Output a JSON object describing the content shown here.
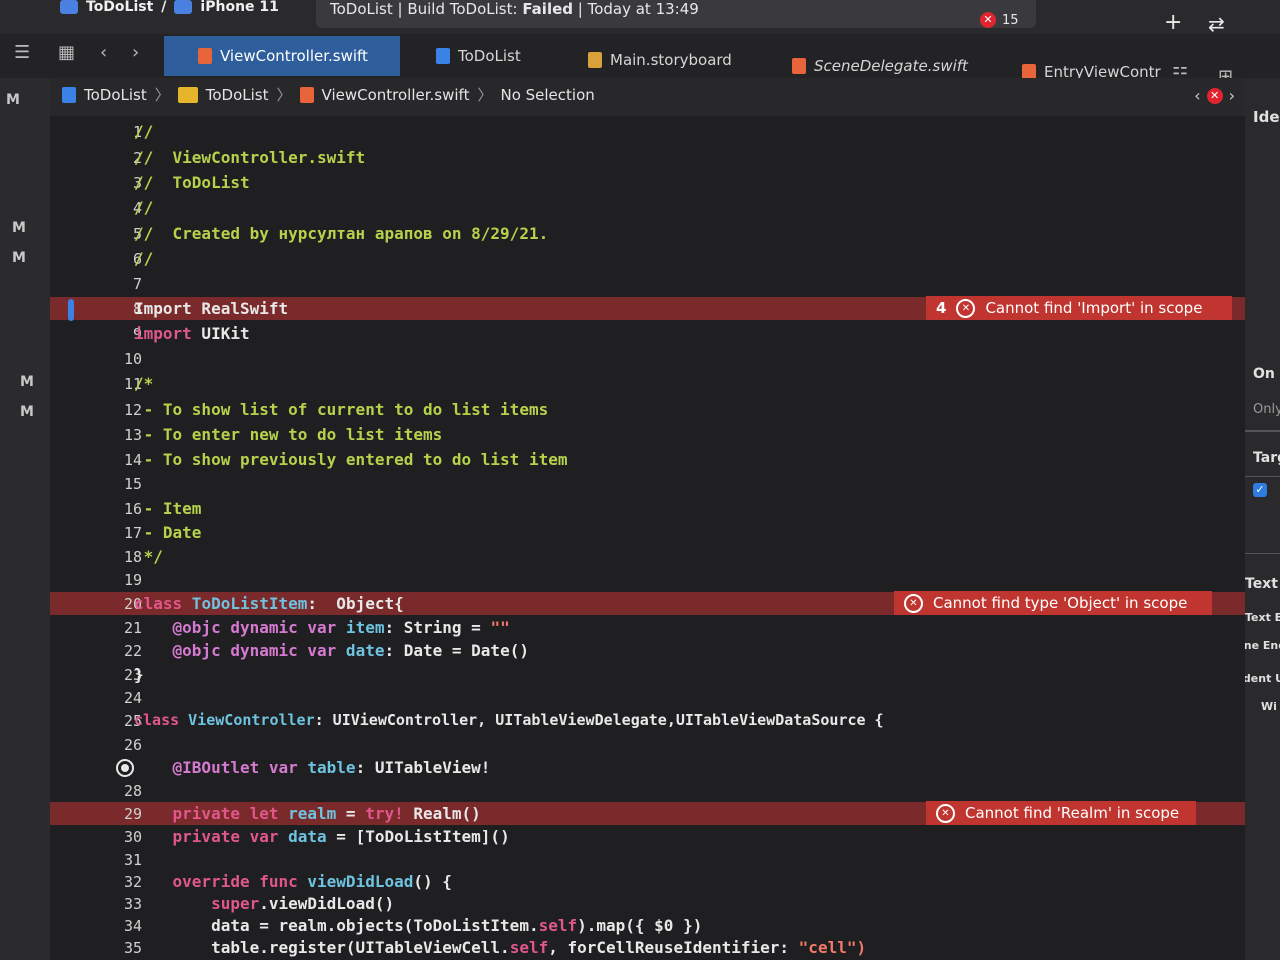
{
  "title_bar": {
    "scheme": "ToDoList",
    "device": "iPhone 11",
    "status_prefix": "ToDoList | Build ToDoList: ",
    "status_state": "Failed",
    "status_suffix": " | Today at 13:49",
    "error_count": "15",
    "add_icon": "+",
    "swap_icon": "⇄"
  },
  "tabs": [
    {
      "label": "ViewController.swift"
    },
    {
      "label": "ToDoList"
    },
    {
      "label": "Main.storyboard"
    },
    {
      "label": "SceneDelegate.swift"
    },
    {
      "label": "EntryViewContr"
    }
  ],
  "jump_bar": {
    "project": "ToDoList",
    "group": "ToDoList",
    "file": "ViewController.swift",
    "selection": "No Selection"
  },
  "source_control_flags": [
    "M",
    "M",
    "M",
    "M",
    "M"
  ],
  "code_lines": [
    {
      "num": "1"
    },
    {
      "num": "2"
    },
    {
      "num": "3"
    },
    {
      "num": "4"
    },
    {
      "num": "5"
    },
    {
      "num": "6"
    },
    {
      "num": "7"
    },
    {
      "num": "8"
    },
    {
      "num": "9"
    },
    {
      "num": "10"
    },
    {
      "num": "11"
    },
    {
      "num": "12"
    },
    {
      "num": "13"
    },
    {
      "num": "14"
    },
    {
      "num": "15"
    },
    {
      "num": "16"
    },
    {
      "num": "17"
    },
    {
      "num": "18"
    },
    {
      "num": "19"
    },
    {
      "num": "20"
    },
    {
      "num": "21"
    },
    {
      "num": "22"
    },
    {
      "num": "23"
    },
    {
      "num": "24"
    },
    {
      "num": "25"
    },
    {
      "num": "26"
    },
    {
      "num": "27"
    },
    {
      "num": "28"
    },
    {
      "num": "29"
    },
    {
      "num": "30"
    },
    {
      "num": "31"
    },
    {
      "num": "32"
    },
    {
      "num": "33"
    },
    {
      "num": "34"
    },
    {
      "num": "35"
    }
  ],
  "code": {
    "l1": "//",
    "l2": "//  ViewController.swift",
    "l3": "//  ToDoList",
    "l4": "//",
    "l5": "//  Created by нурсултан арапов on 8/29/21.",
    "l6": "//",
    "l8": "Import RealSwift",
    "l9a": "import",
    "l9b": " UIKit",
    "l11": "/*",
    "l12": " - To show list of current to do list items",
    "l13": " - To enter new to do list items",
    "l14": " - To show previously entered to do list item",
    "l16": " - Item",
    "l17": " - Date",
    "l18": " */",
    "l20a": "class",
    "l20b": " ToDoListItem",
    "l20c": ":  Object{",
    "l21a": "    @objc dynamic var",
    "l21b": " item",
    "l21c": ": String = ",
    "l21d": "\"\"",
    "l22a": "    @objc dynamic var",
    "l22b": " date",
    "l22c": ": Date = Date()",
    "l23": "}",
    "l25a": "class",
    "l25b": " ViewController",
    "l25c": ": UIViewController, UITableViewDelegate,UITableViewDataSource {",
    "l27a": "    @IBOutlet var",
    "l27b": " table",
    "l27c": ": UITableView!",
    "l29a": "    private let",
    "l29b": " realm",
    "l29c": " = ",
    "l29d": "try!",
    "l29e": " Realm()",
    "l30a": "    private var",
    "l30b": " data",
    "l30c": " = [ToDoListItem]()",
    "l32a": "    override func",
    "l32b": " viewDidLoad",
    "l32c": "() {",
    "l33a": "        super",
    "l33b": ".viewDidLoad()",
    "l34a": "        data = realm.objects(ToDoListItem.",
    "l34b": "self",
    "l34c": ").map({ $0 })",
    "l35a": "        table.register(UITableViewCell.",
    "l35b": "self",
    "l35c": ", forCellReuseIdentifier: ",
    "l35d": "\"cell\")"
  },
  "errors": {
    "import_count": "4",
    "import_msg": "Cannot find 'Import' in scope",
    "object_msg": "Cannot find type 'Object' in scope",
    "realm_msg": "Cannot find 'Realm' in scope"
  },
  "inspector": {
    "identity": "Ide",
    "on_demand": "On De",
    "only": "Only",
    "target": "Target",
    "text_settings": "Text Se",
    "text_encoding": "Text Enc",
    "line_endings": "Line End",
    "indent_using": "Indent U",
    "widths": "Wi"
  }
}
